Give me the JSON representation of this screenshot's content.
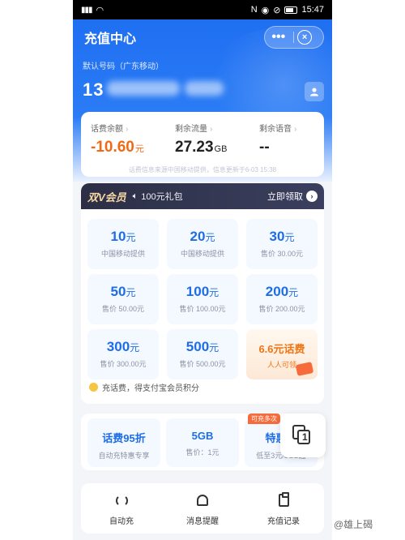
{
  "status_bar": {
    "left_icons": "signal wifi",
    "right_icons": "nfc eye mute",
    "battery_icon": "battery-icon",
    "time": "15:47"
  },
  "header": {
    "title": "充值中心",
    "more": "•••",
    "close": "×"
  },
  "account": {
    "label": "默认号码（广东移动）",
    "number_visible": "13"
  },
  "balance": {
    "items": [
      {
        "label": "话费余额",
        "value": "-10.60",
        "unit": "元"
      },
      {
        "label": "剩余流量",
        "value": "27.23",
        "unit": "GB"
      },
      {
        "label": "剩余语音",
        "value": "--",
        "unit": ""
      }
    ],
    "note": "话费信息来源中国移动提供，信息更新于6-03 15:38"
  },
  "member": {
    "logo": "双V会员",
    "gift": "100元礼包",
    "claim": "立即领取"
  },
  "recharge": {
    "tiles": [
      {
        "amount": "10",
        "unit": "元",
        "sub": "中国移动提供"
      },
      {
        "amount": "20",
        "unit": "元",
        "sub": "中国移动提供"
      },
      {
        "amount": "30",
        "unit": "元",
        "sub": "售价 30.00元"
      },
      {
        "amount": "50",
        "unit": "元",
        "sub": "售价 50.00元"
      },
      {
        "amount": "100",
        "unit": "元",
        "sub": "售价 100.00元"
      },
      {
        "amount": "200",
        "unit": "元",
        "sub": "售价 200.00元"
      },
      {
        "amount": "300",
        "unit": "元",
        "sub": "售价 300.00元"
      },
      {
        "amount": "500",
        "unit": "元",
        "sub": "售价 500.00元"
      }
    ],
    "promo": {
      "title": "6.6元话费",
      "sub": "人人可领"
    },
    "points_text": "充话费，得支付宝会员积分"
  },
  "benefits": [
    {
      "title": "话费95折",
      "sub": "自动充特惠专享",
      "tag": ""
    },
    {
      "title": "5GB",
      "sub": "售价：1元",
      "tag": ""
    },
    {
      "title": "特惠充",
      "sub": "低至3元/5GB起",
      "tag": "可充多次"
    }
  ],
  "float_badge": "1",
  "actions": [
    {
      "label": "自动充",
      "icon": "refresh-icon"
    },
    {
      "label": "消息提醒",
      "icon": "bell-icon"
    },
    {
      "label": "充值记录",
      "icon": "clipboard-icon"
    }
  ],
  "watermark": "@雄上碣",
  "colors": {
    "primary_blue": "#1f6ff2",
    "accent_orange": "#f06a16",
    "member_dark": "#2c2f45"
  }
}
